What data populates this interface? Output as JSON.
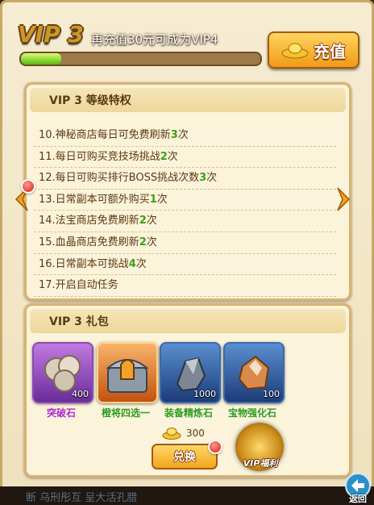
{
  "header": {
    "vip_title": "VIP 3",
    "recharge_hint": "再充值30元可成为VIP4",
    "progress": 0.17,
    "recharge_button": "充值"
  },
  "privileges": {
    "heading": "VIP  3    等级特权",
    "items": [
      {
        "text": "10.神秘商店每日可免费刷新",
        "value": "3",
        "suffix": "次"
      },
      {
        "text": "11.每日可购买竞技场挑战",
        "value": "2",
        "suffix": "次"
      },
      {
        "text": "12.每日可购买排行BOSS挑战次数",
        "value": "3",
        "suffix": "次"
      },
      {
        "text": "13.日常副本可额外购买",
        "value": "1",
        "suffix": "次"
      },
      {
        "text": "14.法宝商店免费刷新",
        "value": "2",
        "suffix": "次"
      },
      {
        "text": "15.血晶商店免费刷新",
        "value": "2",
        "suffix": "次"
      },
      {
        "text": "16.日常副本可挑战",
        "value": "4",
        "suffix": "次"
      },
      {
        "text": "17.开启自动任务",
        "value": "",
        "suffix": ""
      }
    ]
  },
  "gifts": {
    "heading": "VIP  3    礼包",
    "items": [
      {
        "name": "突破石",
        "count": "400",
        "color": "#b02cc9",
        "icon": "breakthrough-stone-icon"
      },
      {
        "name": "橙将四选一",
        "count": "",
        "color": "#2f9a1a",
        "icon": "helmet-chest-icon"
      },
      {
        "name": "装备精炼石",
        "count": "1000",
        "color": "#2f9a1a",
        "icon": "refine-stone-icon"
      },
      {
        "name": "宝物强化石",
        "count": "100",
        "color": "#2f9a1a",
        "icon": "treasure-stone-icon"
      }
    ],
    "cost": "300",
    "exchange_button": "兑换",
    "welfare_label": "VIP福利"
  },
  "footer": {
    "back_label": "返回",
    "chat_text": "断 乌刑彤互     呈大活孔腊"
  },
  "colors": {
    "highlight_green": "#3c9e14",
    "accent_gold": "#f2a51c"
  }
}
